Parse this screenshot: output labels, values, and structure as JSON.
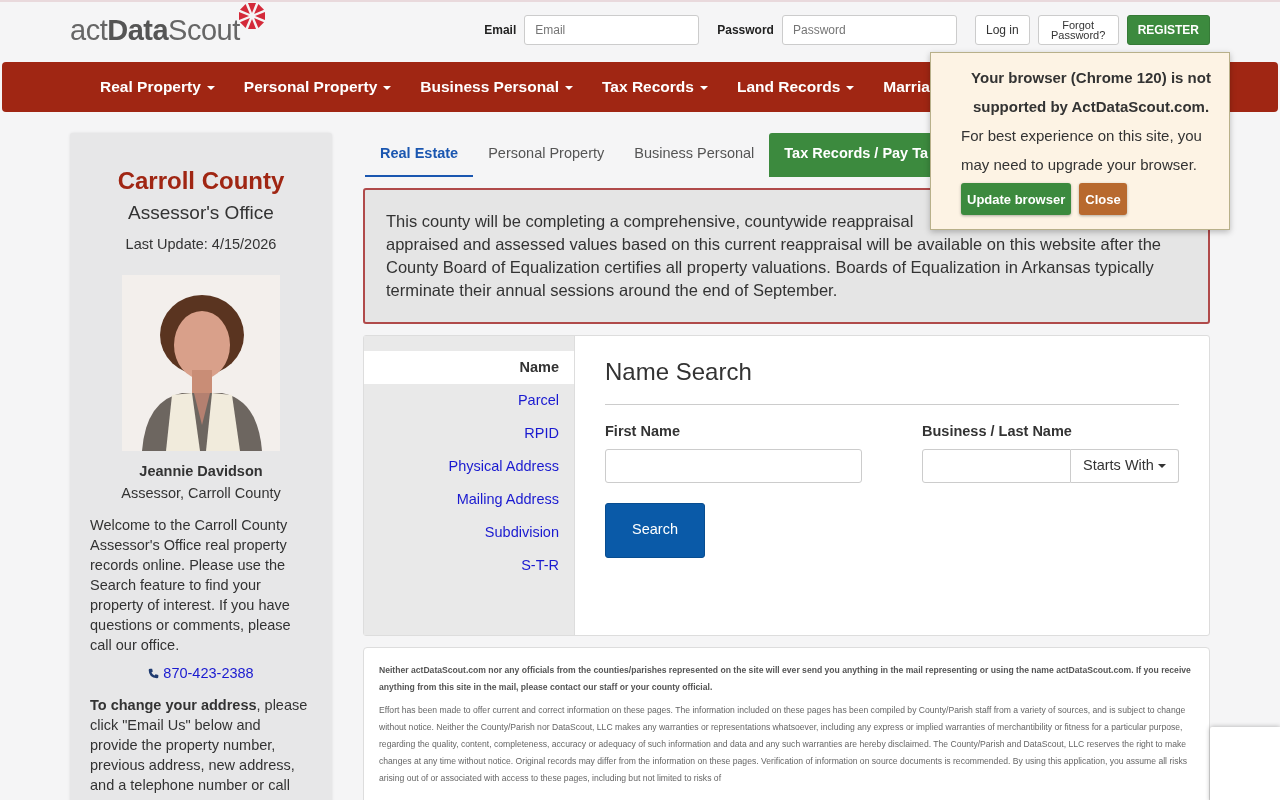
{
  "logo": {
    "text": "act**Data**Scout"
  },
  "login": {
    "fields": [
      {
        "label": "Email",
        "placeholder": "Email"
      },
      {
        "label": "Password",
        "placeholder": "Password"
      }
    ],
    "buttons": [
      {
        "label": "Log in",
        "kind": "default"
      },
      {
        "label": "Forgot Password?",
        "kind": "small"
      },
      {
        "label": "REGISTER",
        "kind": "success"
      }
    ]
  },
  "nav": [
    {
      "label": "Real Property",
      "dropdown": true
    },
    {
      "label": "Personal Property",
      "dropdown": true
    },
    {
      "label": "Business Personal",
      "dropdown": true
    },
    {
      "label": "Tax Records",
      "dropdown": true
    },
    {
      "label": "Land Records",
      "dropdown": true
    },
    {
      "label": "Marria",
      "dropdown": false
    }
  ],
  "sidebar": {
    "title": "Carroll County",
    "subtitle": "Assessor's Office",
    "last_update": "Last Update: 4/15/2026",
    "person_name": "Jeannie Davidson",
    "person_title": "Assessor, Carroll County",
    "welcome": "Welcome to the Carroll County Assessor's Office real property records online. Please use the Search feature to find your property of interest. If you have questions or comments, please call our office.",
    "phone": "870-423-2388",
    "change_address": "**To change your address**, please click \"Email Us\" below and provide the property number, previous address, new address, and a telephone number or call"
  },
  "tabs": [
    {
      "label": "Real Estate",
      "selected": true,
      "kind": "tab"
    },
    {
      "label": "Personal Property",
      "selected": false,
      "kind": "tab"
    },
    {
      "label": "Business Personal",
      "selected": false,
      "kind": "tab"
    },
    {
      "label": "Tax Records / Pay Ta",
      "selected": false,
      "kind": "highlight"
    }
  ],
  "alert": {
    "lines": [
      "This county will be completing a comprehensive, countywide reappraisal",
      "appraised and assessed values based on this current reappraisal will be available on this website after the",
      "County Board of Equalization certifies all property valuations. Boards of Equalization in Arkansas typically",
      "terminate their annual sessions around the end of September."
    ]
  },
  "search": {
    "menu": [
      {
        "label": "Name",
        "selected": true
      },
      {
        "label": "Parcel",
        "selected": false
      },
      {
        "label": "RPID",
        "selected": false
      },
      {
        "label": "Physical Address",
        "selected": false
      },
      {
        "label": "Mailing Address",
        "selected": false
      },
      {
        "label": "Subdivision",
        "selected": false
      },
      {
        "label": "S-T-R",
        "selected": false
      }
    ],
    "heading": "Name Search",
    "fields": [
      {
        "label": "First Name",
        "kind": "text"
      },
      {
        "label": "Business / Last Name",
        "kind": "text-dropdown",
        "dropdown": "Starts With"
      }
    ],
    "button": "Search"
  },
  "disclaimer": {
    "notice": "Neither actDataScout.com nor any officials from the counties/parishes represented on the site will ever send you anything in the mail representing or using the name actDataScout.com. If you receive anything from this site in the mail, please contact our staff or your county official.",
    "body": "Effort has been made to offer current and correct information on these pages. The information included on these pages has been compiled by County/Parish staff from a variety of sources, and is subject to change without notice. Neither the County/Parish nor DataScout, LLC makes any warranties or representations whatsoever, including any express or implied warranties of merchantibility or fitness for a particular purpose, regarding the quality, content, completeness, accuracy or adequacy of such information and data and any such warranties are hereby disclaimed. The County/Parish and DataScout, LLC reserves the right to make changes at any time without notice. Original records may differ from the information on these pages. Verification of information on source documents is recommended. By using this application, you assume all risks arising out of or associated with access to these pages, including but not limited to risks of"
  },
  "popup": {
    "title": "Your browser (Chrome 120) is not supported by ActDataScout.com.",
    "message": "For best experience on this site, you may need to upgrade your browser.",
    "buttons": [
      {
        "label": "Update browser",
        "kind": "update"
      },
      {
        "label": "Close",
        "kind": "close"
      }
    ]
  }
}
